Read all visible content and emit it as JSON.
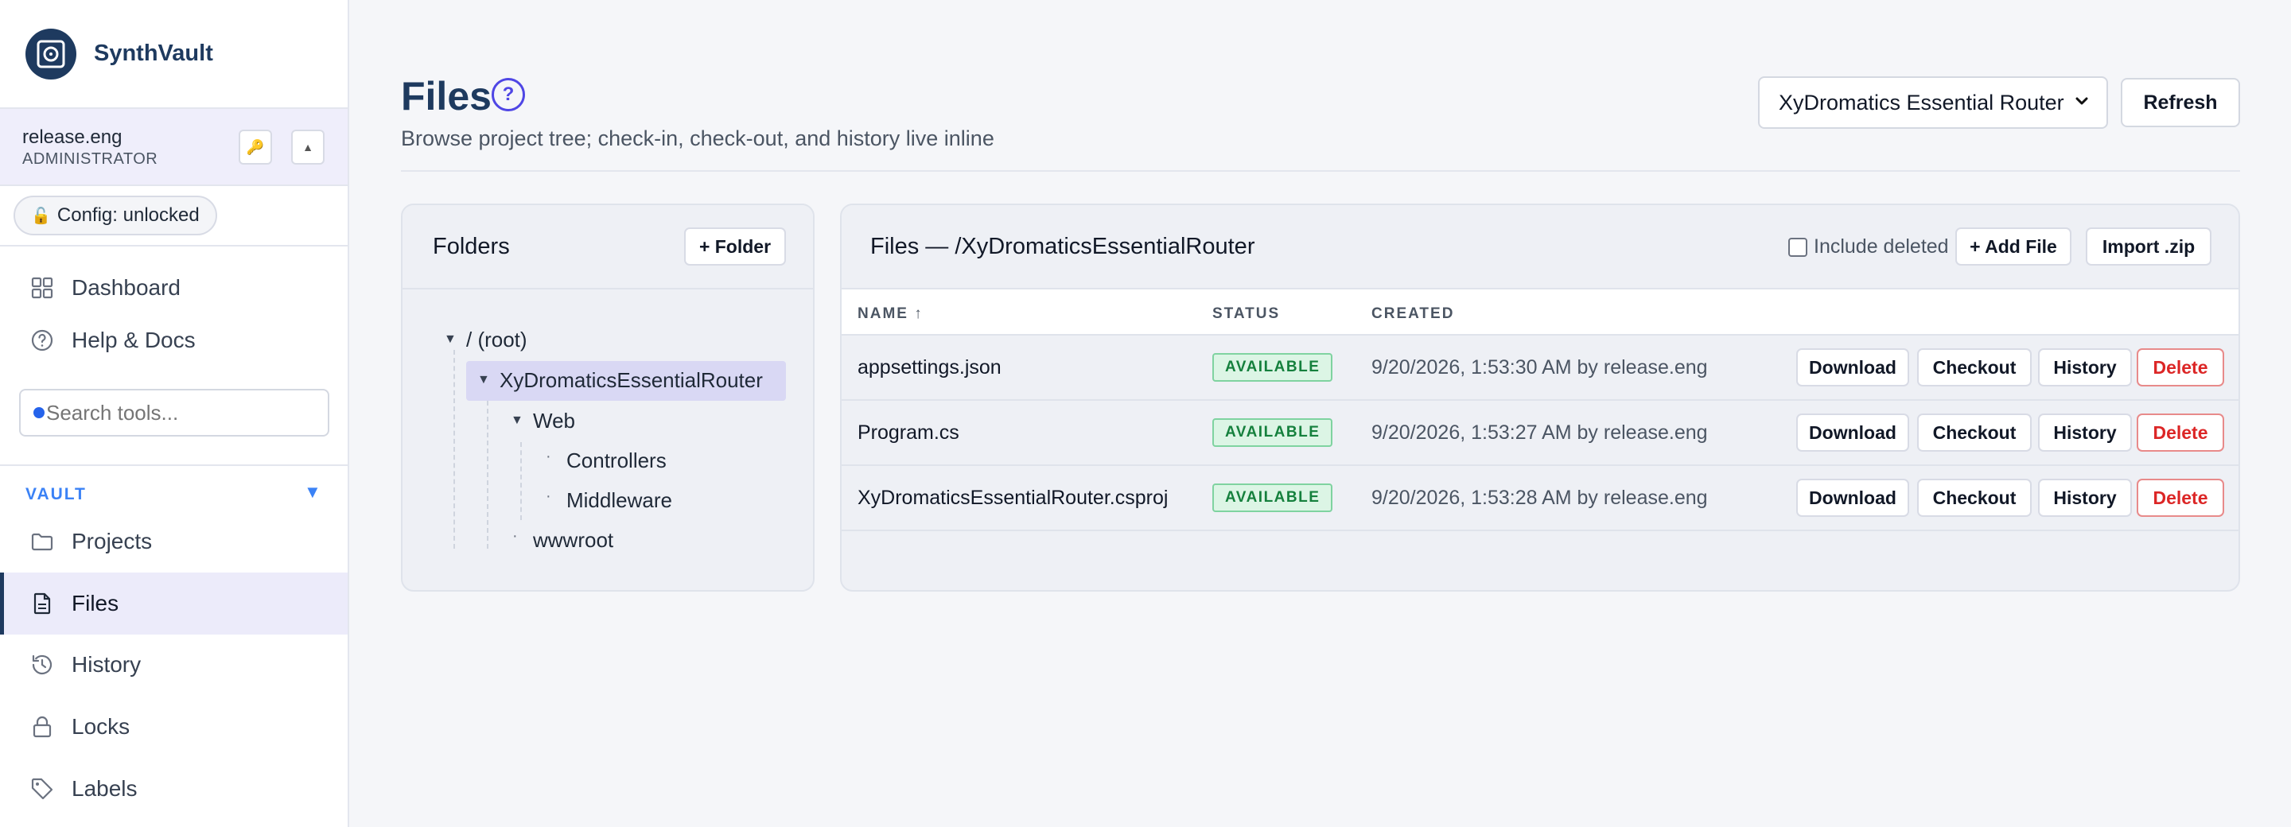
{
  "app": {
    "name": "SynthVault"
  },
  "user": {
    "name": "release.eng",
    "role": "ADMINISTRATOR"
  },
  "config": {
    "label": "Config: unlocked",
    "icon": "unlocked-lock-icon"
  },
  "nav_top": [
    {
      "label": "Dashboard",
      "icon": "dashboard-grid-icon"
    },
    {
      "label": "Help & Docs",
      "icon": "help-circle-icon"
    }
  ],
  "search": {
    "placeholder": "Search tools..."
  },
  "section": {
    "label": "VAULT",
    "toggle": "▼"
  },
  "nav_vault": [
    {
      "label": "Projects",
      "icon": "folder-icon"
    },
    {
      "label": "Files",
      "icon": "file-icon",
      "active": true
    },
    {
      "label": "History",
      "icon": "history-icon"
    },
    {
      "label": "Locks",
      "icon": "lock-icon"
    },
    {
      "label": "Labels",
      "icon": "tag-icon"
    }
  ],
  "page": {
    "title": "Files",
    "help": "?",
    "subtitle": "Browse project tree; check-in, check-out, and history live inline",
    "project_select": "XyDromatics Essential Router",
    "refresh_label": "Refresh"
  },
  "folders": {
    "title": "Folders",
    "add_label": "+ Folder",
    "tree": {
      "root": "/ (root)",
      "project": "XyDromaticsEssentialRouter",
      "web": "Web",
      "controllers": "Controllers",
      "middleware": "Middleware",
      "wwwroot": "wwwroot"
    }
  },
  "files": {
    "title": "Files — /XyDromaticsEssentialRouter",
    "include_deleted": "Include deleted",
    "add_file_label": "+ Add File",
    "import_label": "Import .zip",
    "columns": {
      "name": "NAME ↑",
      "status": "STATUS",
      "created": "CREATED"
    },
    "actions": {
      "download": "Download",
      "checkout": "Checkout",
      "history": "History",
      "delete": "Delete"
    },
    "rows": [
      {
        "name": "appsettings.json",
        "status": "AVAILABLE",
        "created": "9/20/2026, 1:53:30 AM by release.eng"
      },
      {
        "name": "Program.cs",
        "status": "AVAILABLE",
        "created": "9/20/2026, 1:53:27 AM by release.eng"
      },
      {
        "name": "XyDromaticsEssentialRouter.csproj",
        "status": "AVAILABLE",
        "created": "9/20/2026, 1:53:28 AM by release.eng"
      }
    ]
  },
  "colors": {
    "brand": "#1e3a5f",
    "accent": "#4f46e5",
    "success": "#15803d",
    "danger": "#dc2626"
  }
}
